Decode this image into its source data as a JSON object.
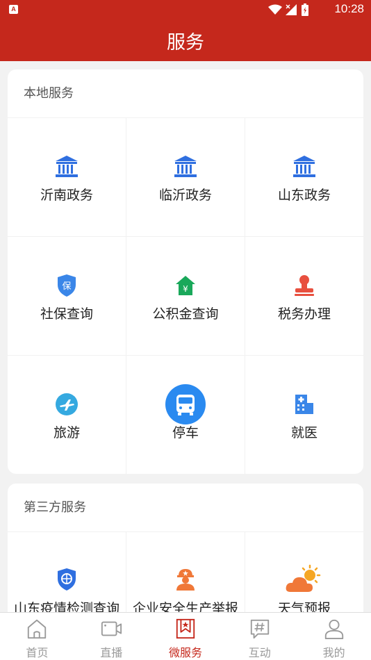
{
  "status_bar": {
    "app_indicator": "A",
    "time": "10:28"
  },
  "header": {
    "title": "服务"
  },
  "local_services": {
    "title": "本地服务",
    "items": [
      {
        "label": "沂南政务",
        "icon": "government-building-icon"
      },
      {
        "label": "临沂政务",
        "icon": "government-building-icon"
      },
      {
        "label": "山东政务",
        "icon": "government-building-icon"
      },
      {
        "label": "社保查询",
        "icon": "social-security-shield-icon"
      },
      {
        "label": "公积金查询",
        "icon": "housing-fund-icon"
      },
      {
        "label": "税务办理",
        "icon": "tax-stamp-icon"
      },
      {
        "label": "旅游",
        "icon": "travel-plane-icon"
      },
      {
        "label": "停车",
        "icon": "bus-icon"
      },
      {
        "label": "就医",
        "icon": "hospital-icon"
      }
    ]
  },
  "third_party_services": {
    "title": "第三方服务",
    "items": [
      {
        "label": "山东疫情检测查询",
        "icon": "epidemic-check-shield-icon"
      },
      {
        "label": "企业安全生产举报",
        "icon": "worker-safety-icon"
      },
      {
        "label": "天气预报",
        "icon": "weather-sun-cloud-icon"
      }
    ]
  },
  "tab_bar": {
    "tabs": [
      {
        "label": "首页",
        "icon": "home-icon",
        "active": false
      },
      {
        "label": "直播",
        "icon": "video-camera-icon",
        "active": false
      },
      {
        "label": "微服务",
        "icon": "bookmark-star-icon",
        "active": true
      },
      {
        "label": "互动",
        "icon": "hashtag-chat-icon",
        "active": false
      },
      {
        "label": "我的",
        "icon": "user-icon",
        "active": false
      }
    ]
  },
  "colors": {
    "brand_red": "#c5281c",
    "icon_blue": "#2f6fe0",
    "icon_green": "#19a85a",
    "icon_red": "#e8503f",
    "icon_orange": "#f07838"
  }
}
